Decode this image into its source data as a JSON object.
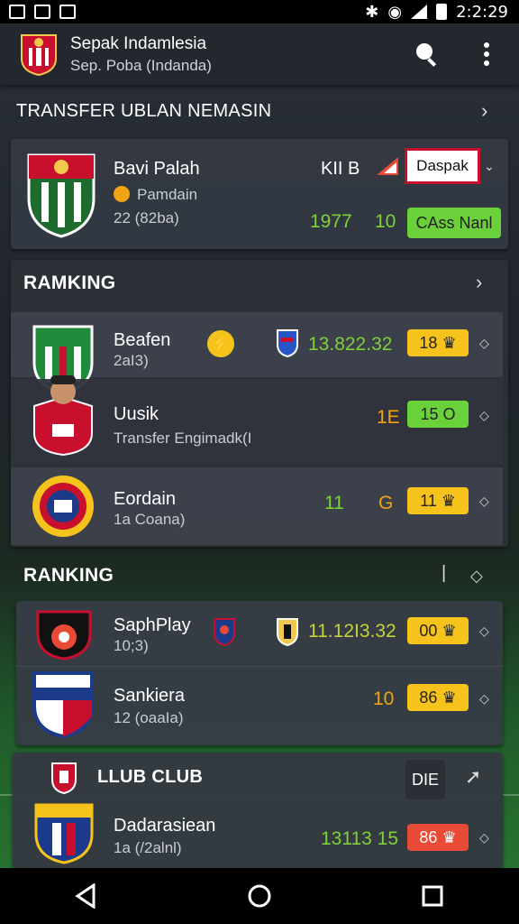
{
  "status": {
    "time": "2:2:29"
  },
  "app": {
    "title": "Sepak Indamlesia",
    "subtitle": "Sep. Poba (Indanda)"
  },
  "transfer": {
    "header": "TRANSFER UBLAN NEMASIN",
    "player_name": "Bavi Palah",
    "position": "Pamdain",
    "detail": "22 (82ba)",
    "club_code": "KII B",
    "dropdown_value": "Daspak",
    "year": "1977",
    "number": "10",
    "action_label": "CAss Nanl"
  },
  "ranking1": {
    "title": "RAMKING",
    "rows": [
      {
        "name": "Beafen",
        "sub": "2aI3)",
        "value": "13.822.32",
        "badge": "18"
      },
      {
        "name": "Uusik",
        "sub": "Transfer Engimadk(I",
        "value": "1E",
        "badge": "15"
      },
      {
        "name": "Eordain",
        "sub": "1a Coana)",
        "value": "11",
        "value2": "G",
        "badge": "11"
      }
    ]
  },
  "ranking2": {
    "title": "RANKING",
    "rows": [
      {
        "name": "SaphPlay",
        "sub": "10;3)",
        "value": "11.12I3.32",
        "badge": "00"
      },
      {
        "name": "Sankiera",
        "sub": "12 (oaaIa)",
        "value": "10",
        "badge": "86"
      }
    ]
  },
  "club": {
    "title": "LLUB CLUB",
    "button_label": "DIE",
    "row": {
      "name": "Dadarasiean",
      "sub": "1a (/2alnl)",
      "value": "13113 15",
      "badge": "86"
    }
  },
  "colors": {
    "green": "#7ed13a",
    "orange": "#f2a514",
    "yellow": "#f6c31d",
    "red": "#e84a35"
  },
  "icons": [
    "search-icon",
    "more-vert-icon",
    "chevron-right-icon",
    "back-icon",
    "home-icon",
    "recents-icon"
  ]
}
